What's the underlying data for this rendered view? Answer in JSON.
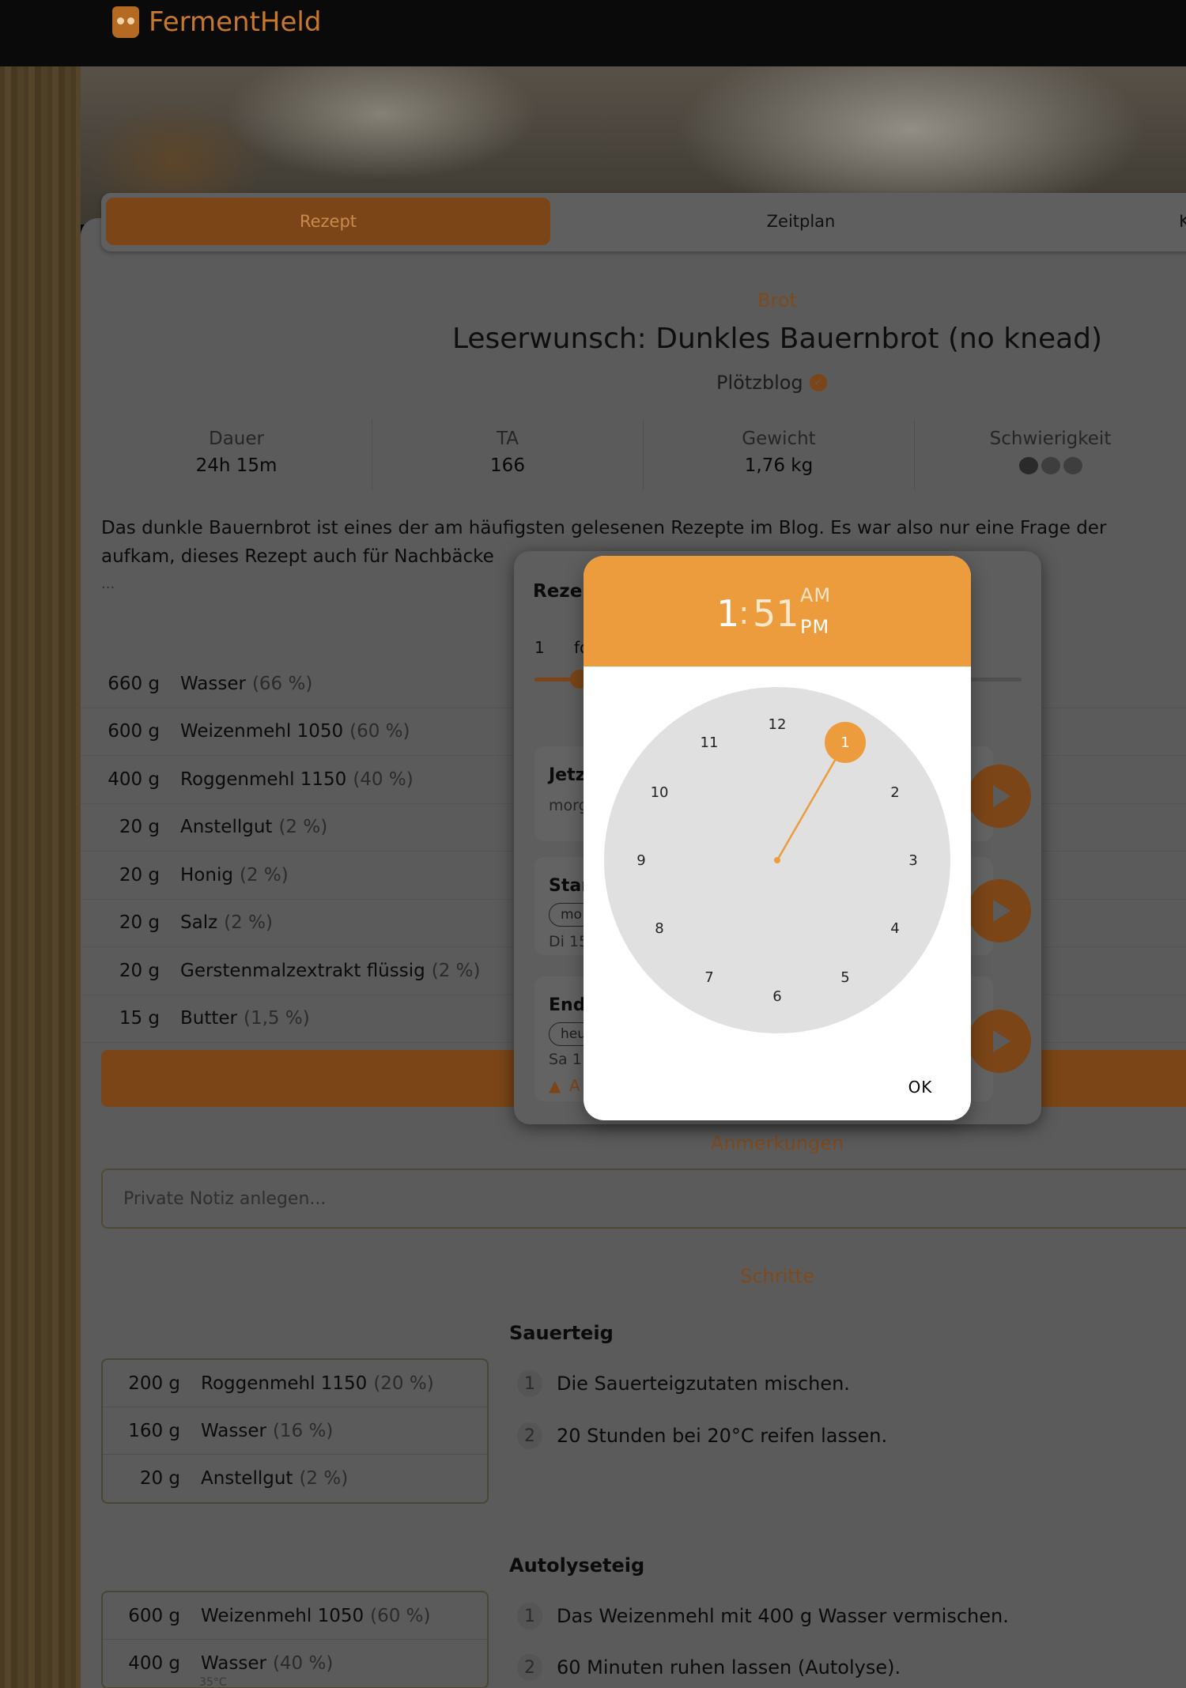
{
  "app": {
    "brand": "FermentHeld"
  },
  "tabs": [
    {
      "label": "Rezept"
    },
    {
      "label": "Zeitplan"
    },
    {
      "label": "K"
    }
  ],
  "recipe": {
    "category": "Brot",
    "title": "Leserwunsch: Dunkles Bauernbrot (no knead)",
    "author": "Plötzblog",
    "stats": [
      {
        "label": "Dauer",
        "value": "24h 15m"
      },
      {
        "label": "TA",
        "value": "166"
      },
      {
        "label": "Gewicht",
        "value": "1,76 kg"
      },
      {
        "label": "Schwierigkeit",
        "value": ""
      }
    ],
    "difficulty": 1,
    "description_line1": "Das dunkle Bauernbrot ist eines der am häufigsten gelesenen Rezepte im Blog. Es war also nur eine Frage der",
    "description_line2": "aufkam, dieses Rezept auch für Nachbäcke",
    "description_more": "...",
    "ingredients": [
      {
        "amount": "660 g",
        "name": "Wasser",
        "pct": "(66 %)"
      },
      {
        "amount": "600 g",
        "name": "Weizenmehl 1050",
        "pct": "(60 %)"
      },
      {
        "amount": "400 g",
        "name": "Roggenmehl 1150",
        "pct": "(40 %)"
      },
      {
        "amount": "20 g",
        "name": "Anstellgut",
        "pct": "(2 %)"
      },
      {
        "amount": "20 g",
        "name": "Honig",
        "pct": "(2 %)"
      },
      {
        "amount": "20 g",
        "name": "Salz",
        "pct": "(2 %)"
      },
      {
        "amount": "20 g",
        "name": "Gerstenmalzextrakt flüssig",
        "pct": "(2 %)"
      },
      {
        "amount": "15 g",
        "name": "Butter",
        "pct": "(1,5 %)"
      }
    ]
  },
  "notes": {
    "heading": "Anmerkungen",
    "placeholder": "Private Notiz anlegen..."
  },
  "steps": {
    "heading": "Schritte",
    "sections": [
      {
        "title": "Sauerteig",
        "ingredients": [
          {
            "amount": "200 g",
            "name": "Roggenmehl 1150",
            "pct": "(20 %)"
          },
          {
            "amount": "160 g",
            "name": "Wasser",
            "pct": "(16 %)"
          },
          {
            "amount": "20 g",
            "name": "Anstellgut",
            "pct": "(2 %)"
          }
        ],
        "items": [
          {
            "num": "1",
            "text": "Die Sauerteigzutaten mischen."
          },
          {
            "num": "2",
            "text": "20 Stunden bei 20°C reifen lassen."
          }
        ]
      },
      {
        "title": "Autolyseteig",
        "ingredients": [
          {
            "amount": "600 g",
            "name": "Weizenmehl 1050",
            "pct": "(60 %)"
          },
          {
            "amount": "400 g",
            "name": "Wasser",
            "pct": "(40 %)"
          }
        ],
        "temp_note": "35°C",
        "items": [
          {
            "num": "1",
            "text": "Das Weizenmehl mit 400 g Wasser vermischen."
          },
          {
            "num": "2",
            "text": "60 Minuten ruhen lassen (Autolyse)."
          }
        ]
      }
    ]
  },
  "scheduler": {
    "title": "Rezep",
    "quantity": "1",
    "quantity_label": "fo",
    "quantity_fraction": 0.05,
    "cards": [
      {
        "heading": "Jetz",
        "sub": "morg"
      },
      {
        "heading": "Star",
        "chip": "mo",
        "sub": "Di 15"
      },
      {
        "heading": "End",
        "chip": "heu",
        "sub": "Sa 1",
        "warn": "A"
      }
    ]
  },
  "time_picker": {
    "hour": "1",
    "colon": ":",
    "minute": "51",
    "am_label": "AM",
    "pm_label": "PM",
    "period": "PM",
    "selected_hour": 1,
    "numbers": [
      "12",
      "1",
      "2",
      "3",
      "4",
      "5",
      "6",
      "7",
      "8",
      "9",
      "10",
      "11"
    ],
    "ok_label": "OK",
    "accent": "#ec9b3d"
  }
}
